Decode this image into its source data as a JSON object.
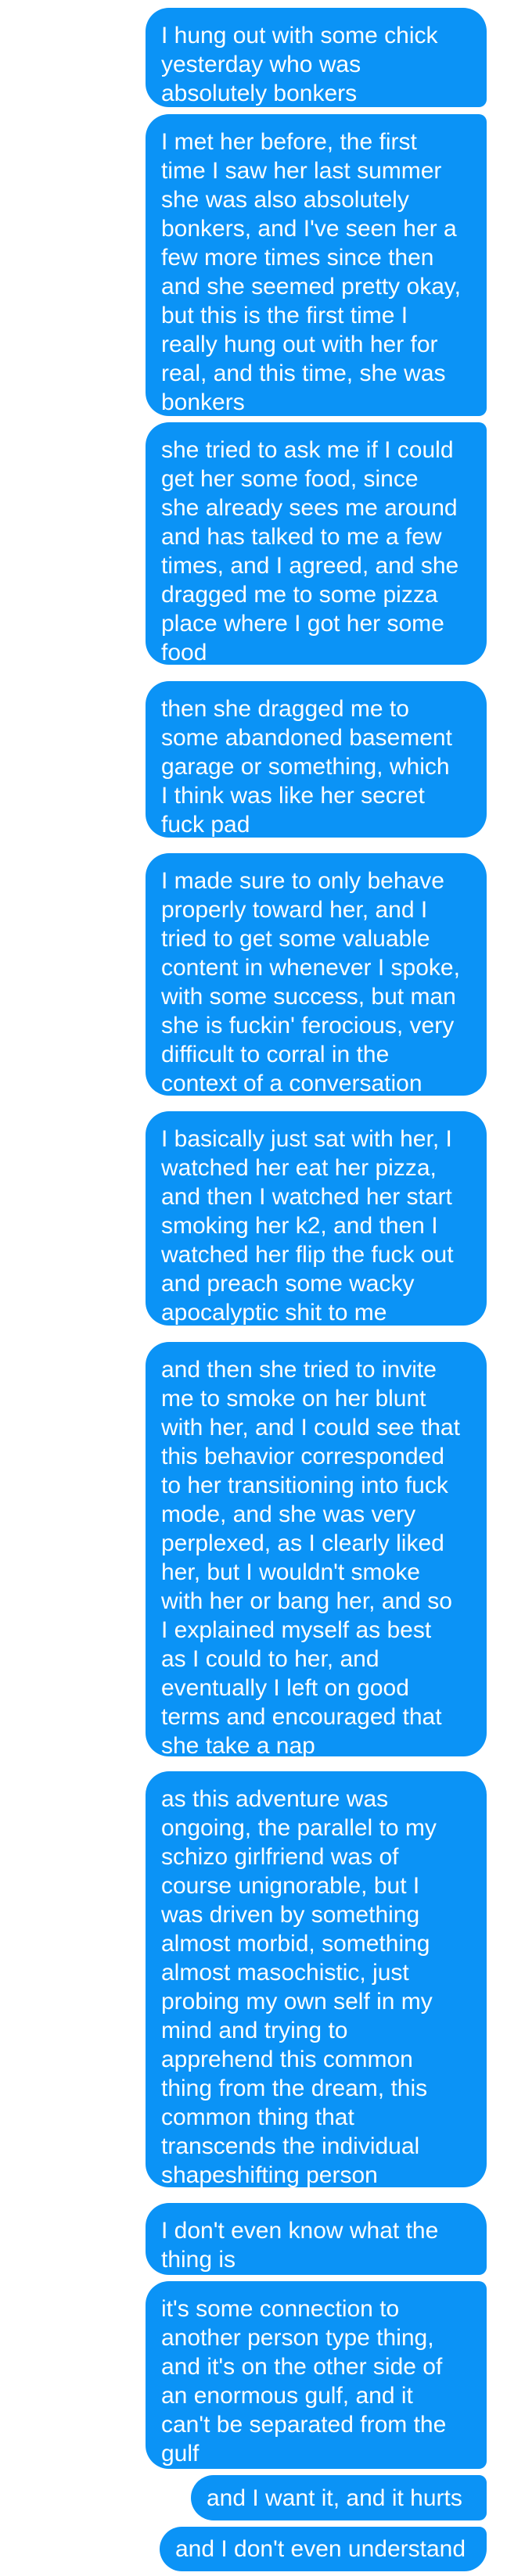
{
  "conversation": {
    "messages": [
      "I hung out with some chick\nyesterday who was\nabsolutely bonkers",
      "I met her before, the first\ntime I saw her last summer\nshe was also absolutely\nbonkers, and I've seen her a\nfew more times since then\nand she seemed pretty okay,\nbut this is the first time I\nreally hung out with her for\nreal, and this time, she was\nbonkers",
      "she tried to ask me if I could\nget her some food, since\nshe already sees me around\nand has talked to me a few\ntimes, and I agreed, and she\ndragged me to some pizza\nplace where I got her some\nfood",
      "then she dragged me to\nsome abandoned basement\ngarage or something, which\nI think was like her secret\nfuck pad",
      "I made sure to only behave\nproperly toward her, and I\ntried to get some valuable\ncontent in whenever I spoke,\nwith some success, but man\nshe is fuckin' ferocious, very\ndifficult to corral in the\ncontext of a conversation",
      "I basically just sat with her, I\nwatched her eat her pizza,\nand then I watched her start\nsmoking her k2, and then I\nwatched her flip the fuck out\nand preach some wacky\napocalyptic shit to me",
      "and then she tried to invite\nme to smoke on her blunt\nwith her, and I could see that\nthis behavior corresponded\nto her transitioning into fuck\nmode, and she was very\nperplexed, as I clearly liked\nher, but I wouldn't smoke\nwith her or bang her, and so\nI explained myself as best\nas I could to her, and\neventually I left on good\nterms and encouraged that\nshe take a nap",
      "as this adventure was\nongoing, the parallel to my\nschizo girlfriend was of\ncourse unignorable, but I\nwas driven by something\nalmost morbid, something\nalmost masochistic, just\nprobing my own self in my\nmind and trying to\napprehend this common\nthing from the dream, this\ncommon thing that\ntranscends the individual\nshapeshifting person",
      "I don't even know what the\nthing is",
      "it's some connection to\nanother person type thing,\nand it's on the other side of\nan enormous gulf, and it\ncan't be separated from the\ngulf",
      "and I want it, and it hurts",
      "and I don't even understand"
    ]
  },
  "colors": {
    "bubble": "#0b93f6",
    "bubble_text": "#ffffff",
    "background": "#ffffff"
  }
}
